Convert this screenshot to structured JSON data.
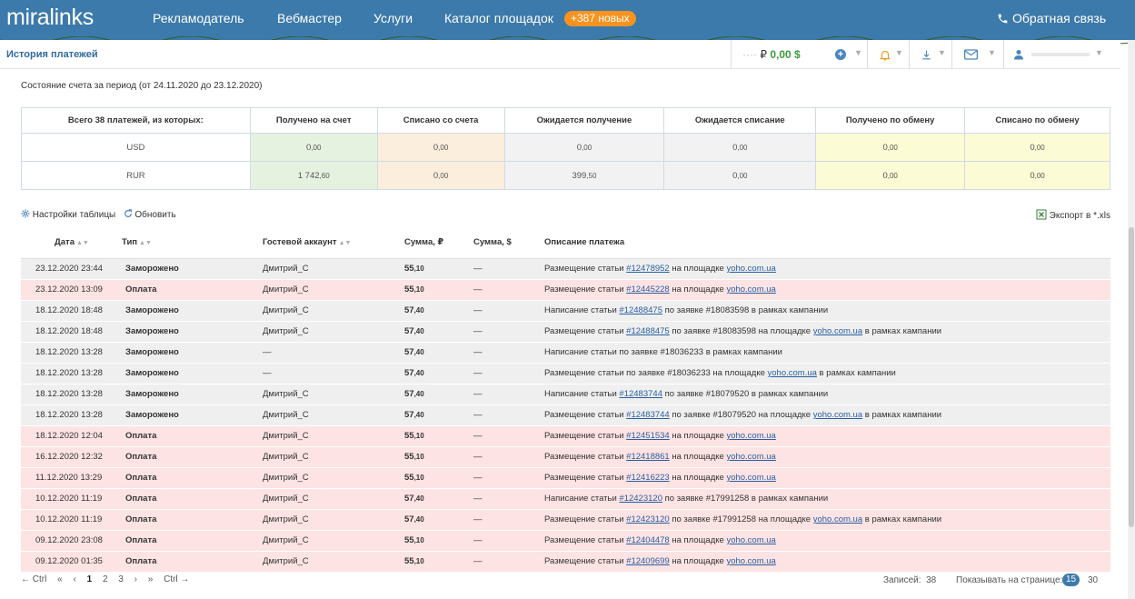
{
  "header": {
    "logo": "miralinks",
    "nav": [
      "Рекламодатель",
      "Вебмастер",
      "Услуги",
      "Каталог площадок"
    ],
    "badge_new": "+387 новых",
    "feedback": "Обратная связь"
  },
  "subheader": {
    "title": "История платежей",
    "balance_rub": "₽",
    "balance_usd": "0,00 $"
  },
  "summary": {
    "period": "Состояние счета за период (от 24.11.2020 до 23.12.2020)",
    "headers": [
      "Всего 38 платежей, из которых:",
      "Получено на счет",
      "Списано со счета",
      "Ожидается получение",
      "Ожидается списание",
      "Получено по обмену",
      "Списано по обмену"
    ],
    "rows": [
      {
        "currency": "USD",
        "values": [
          [
            "0",
            ",00"
          ],
          [
            "0",
            ",00"
          ],
          [
            "0",
            ",00"
          ],
          [
            "0",
            ",00"
          ],
          [
            "0",
            ",00"
          ],
          [
            "0",
            ",00"
          ]
        ]
      },
      {
        "currency": "RUR",
        "values": [
          [
            "1 742",
            ",60"
          ],
          [
            "0",
            ",00"
          ],
          [
            "399",
            ",50"
          ],
          [
            "0",
            ",00"
          ],
          [
            "0",
            ",00"
          ],
          [
            "0",
            ",00"
          ]
        ]
      }
    ]
  },
  "tools": {
    "settings": "Настройки таблицы",
    "refresh": "Обновить",
    "export": "Экспорт в *.xls"
  },
  "payments": {
    "headers": {
      "date": "Дата",
      "type": "Тип",
      "guest": "Гостевой аккаунт",
      "sum_rub": "Сумма, ₽",
      "sum_usd": "Сумма, $",
      "description": "Описание платежа"
    },
    "rows": [
      {
        "date": "23.12.2020 23:44",
        "type": "Заморожено",
        "kind": "frozen",
        "guest": "Дмитрий_С",
        "sum": [
          "55",
          ",10"
        ],
        "usd": "—",
        "desc": [
          [
            "Размещение статьи ",
            false
          ],
          [
            "#12478952",
            true
          ],
          [
            " на площадке ",
            false
          ],
          [
            "yoho.com.ua",
            true
          ]
        ]
      },
      {
        "date": "23.12.2020 13:09",
        "type": "Оплата",
        "kind": "paid",
        "guest": "Дмитрий_С",
        "sum": [
          "55",
          ",10"
        ],
        "usd": "—",
        "desc": [
          [
            "Размещение статьи ",
            false
          ],
          [
            "#12445228",
            true
          ],
          [
            " на площадке ",
            false
          ],
          [
            "yoho.com.ua",
            true
          ]
        ]
      },
      {
        "date": "18.12.2020 18:48",
        "type": "Заморожено",
        "kind": "frozen",
        "guest": "Дмитрий_С",
        "sum": [
          "57",
          ",40"
        ],
        "usd": "—",
        "desc": [
          [
            "Написание статьи ",
            false
          ],
          [
            "#12488475",
            true
          ],
          [
            " по заявке #18083598 в рамках кампании",
            false
          ]
        ]
      },
      {
        "date": "18.12.2020 18:48",
        "type": "Заморожено",
        "kind": "frozen",
        "guest": "Дмитрий_С",
        "sum": [
          "57",
          ",40"
        ],
        "usd": "—",
        "desc": [
          [
            "Размещение статьи ",
            false
          ],
          [
            "#12488475",
            true
          ],
          [
            " по заявке #18083598 на площадке ",
            false
          ],
          [
            "yoho.com.ua",
            true
          ],
          [
            " в рамках кампании",
            false
          ]
        ]
      },
      {
        "date": "18.12.2020 13:28",
        "type": "Заморожено",
        "kind": "frozen",
        "guest": "—",
        "sum": [
          "57",
          ",40"
        ],
        "usd": "—",
        "desc": [
          [
            "Написание статьи по заявке #18036233 в рамках кампании",
            false
          ]
        ]
      },
      {
        "date": "18.12.2020 13:28",
        "type": "Заморожено",
        "kind": "frozen",
        "guest": "—",
        "sum": [
          "57",
          ",40"
        ],
        "usd": "—",
        "desc": [
          [
            "Размещение статьи по заявке #18036233 на площадке ",
            false
          ],
          [
            "yoho.com.ua",
            true
          ],
          [
            " в рамках кампании",
            false
          ]
        ]
      },
      {
        "date": "18.12.2020 13:28",
        "type": "Заморожено",
        "kind": "frozen",
        "guest": "Дмитрий_С",
        "sum": [
          "57",
          ",40"
        ],
        "usd": "—",
        "desc": [
          [
            "Написание статьи ",
            false
          ],
          [
            "#12483744",
            true
          ],
          [
            " по заявке #18079520 в рамках кампании",
            false
          ]
        ]
      },
      {
        "date": "18.12.2020 13:28",
        "type": "Заморожено",
        "kind": "frozen",
        "guest": "Дмитрий_С",
        "sum": [
          "57",
          ",40"
        ],
        "usd": "—",
        "desc": [
          [
            "Размещение статьи ",
            false
          ],
          [
            "#12483744",
            true
          ],
          [
            " по заявке #18079520 на площадке ",
            false
          ],
          [
            "yoho.com.ua",
            true
          ],
          [
            " в рамках кампании",
            false
          ]
        ]
      },
      {
        "date": "18.12.2020 12:04",
        "type": "Оплата",
        "kind": "paid",
        "guest": "Дмитрий_С",
        "sum": [
          "55",
          ",10"
        ],
        "usd": "—",
        "desc": [
          [
            "Размещение статьи ",
            false
          ],
          [
            "#12451534",
            true
          ],
          [
            " на площадке ",
            false
          ],
          [
            "yoho.com.ua",
            true
          ]
        ]
      },
      {
        "date": "16.12.2020 12:32",
        "type": "Оплата",
        "kind": "paid",
        "guest": "Дмитрий_С",
        "sum": [
          "55",
          ",10"
        ],
        "usd": "—",
        "desc": [
          [
            "Размещение статьи ",
            false
          ],
          [
            "#12418861",
            true
          ],
          [
            " на площадке ",
            false
          ],
          [
            "yoho.com.ua",
            true
          ]
        ]
      },
      {
        "date": "11.12.2020 13:29",
        "type": "Оплата",
        "kind": "paid",
        "guest": "Дмитрий_С",
        "sum": [
          "55",
          ",10"
        ],
        "usd": "—",
        "desc": [
          [
            "Размещение статьи ",
            false
          ],
          [
            "#12416223",
            true
          ],
          [
            " на площадке ",
            false
          ],
          [
            "yoho.com.ua",
            true
          ]
        ]
      },
      {
        "date": "10.12.2020 11:19",
        "type": "Оплата",
        "kind": "paid",
        "guest": "Дмитрий_С",
        "sum": [
          "57",
          ",40"
        ],
        "usd": "—",
        "desc": [
          [
            "Написание статьи ",
            false
          ],
          [
            "#12423120",
            true
          ],
          [
            " по заявке #17991258 в рамках кампании",
            false
          ]
        ]
      },
      {
        "date": "10.12.2020 11:19",
        "type": "Оплата",
        "kind": "paid",
        "guest": "Дмитрий_С",
        "sum": [
          "57",
          ",40"
        ],
        "usd": "—",
        "desc": [
          [
            "Размещение статьи ",
            false
          ],
          [
            "#12423120",
            true
          ],
          [
            " по заявке #17991258 на площадке ",
            false
          ],
          [
            "yoho.com.ua",
            true
          ],
          [
            " в рамках кампании",
            false
          ]
        ]
      },
      {
        "date": "09.12.2020 23:08",
        "type": "Оплата",
        "kind": "paid",
        "guest": "Дмитрий_С",
        "sum": [
          "55",
          ",10"
        ],
        "usd": "—",
        "desc": [
          [
            "Размещение статьи ",
            false
          ],
          [
            "#12404478",
            true
          ],
          [
            " на площадке ",
            false
          ],
          [
            "yoho.com.ua",
            true
          ]
        ]
      },
      {
        "date": "09.12.2020 01:35",
        "type": "Оплата",
        "kind": "paid",
        "guest": "Дмитрий_С",
        "sum": [
          "55",
          ",10"
        ],
        "usd": "—",
        "desc": [
          [
            "Размещение статьи ",
            false
          ],
          [
            "#12409699",
            true
          ],
          [
            " на площадке ",
            false
          ],
          [
            "yoho.com.ua",
            true
          ]
        ]
      }
    ]
  },
  "pager": {
    "prev_hint": "← Ctrl",
    "first": "«",
    "prev": "‹",
    "pages": [
      "1",
      "2",
      "3"
    ],
    "next": "›",
    "last": "»",
    "next_hint": "Ctrl →",
    "records_label": "Записей:",
    "records": "38",
    "per_page_label": "Показывать на странице:",
    "per_page_active": "15",
    "per_page_other": "30"
  }
}
